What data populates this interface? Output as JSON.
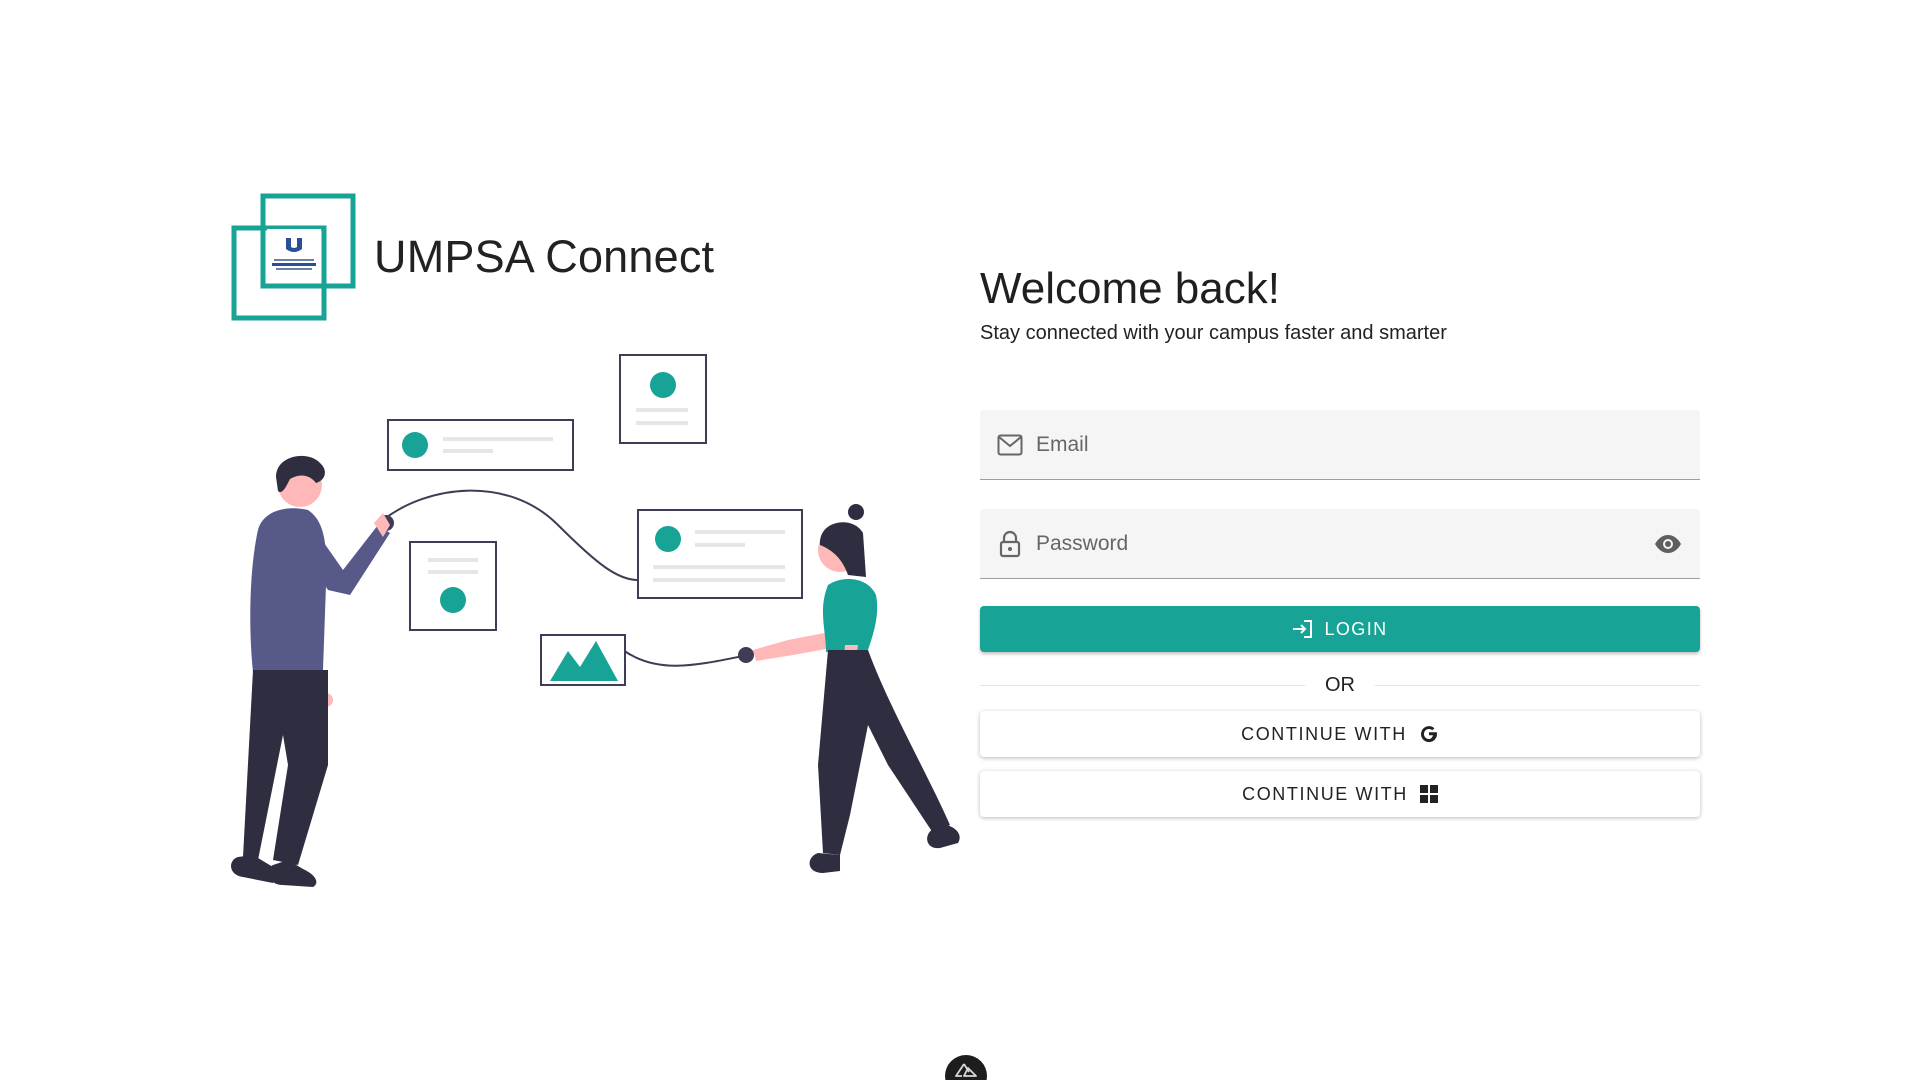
{
  "brand": {
    "name": "UMPSA Connect",
    "accent_color": "#17a396"
  },
  "login": {
    "title": "Welcome back!",
    "subtitle": "Stay connected with your campus faster and smarter",
    "email_placeholder": "Email",
    "email_icon": "mail-icon",
    "password_placeholder": "Password",
    "password_icon": "lock-icon",
    "toggle_visibility_icon": "eye-icon",
    "login_label": "LOGIN",
    "login_icon": "login-icon",
    "divider_label": "OR",
    "google_label": "CONTINUE WITH",
    "google_icon": "google-icon",
    "microsoft_label": "CONTINUE WITH",
    "microsoft_icon": "microsoft-icon",
    "button_color": "#17a396"
  },
  "devtools": {
    "badge_icon": "nuxt-icon"
  }
}
